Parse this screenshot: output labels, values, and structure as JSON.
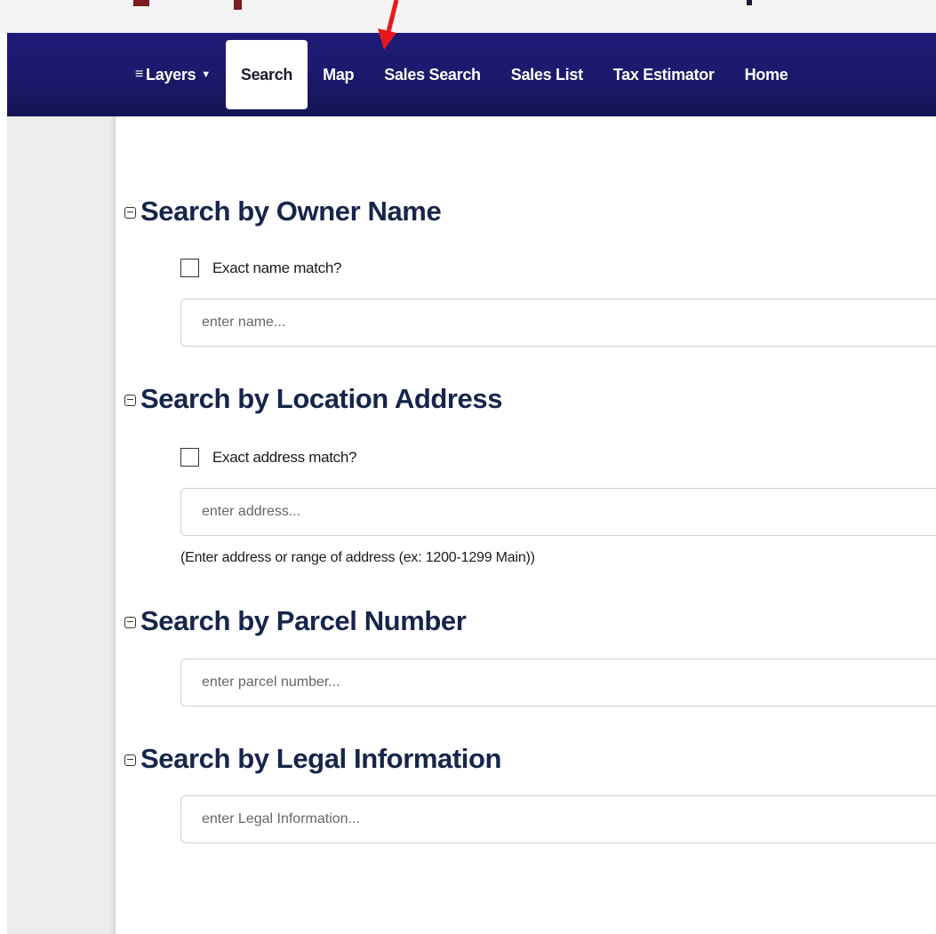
{
  "navbar": {
    "items": [
      {
        "label": "Layers",
        "icon": "layers-icon",
        "has_dropdown": true
      },
      {
        "label": "Search",
        "active": true
      },
      {
        "label": "Map"
      },
      {
        "label": "Sales Search"
      },
      {
        "label": "Sales List"
      },
      {
        "label": "Tax Estimator"
      },
      {
        "label": "Home"
      }
    ],
    "colors": {
      "background": "#1c1a6e",
      "text": "#ffffff",
      "active_background": "#ffffff",
      "active_text": "#1b1b2e"
    }
  },
  "annotation": {
    "type": "red-arrow",
    "points_to": "Map",
    "color": "#e8161b"
  },
  "sections": {
    "owner": {
      "title": "Search by Owner Name",
      "checkbox_label": "Exact name match?",
      "checkbox_checked": false,
      "input_placeholder": "enter name...",
      "input_value": ""
    },
    "address": {
      "title": "Search by Location Address",
      "checkbox_label": "Exact address match?",
      "checkbox_checked": false,
      "input_placeholder": "enter address...",
      "input_value": "",
      "helper": "(Enter address or range of address (ex: 1200-1299 Main))"
    },
    "parcel": {
      "title": "Search by Parcel Number",
      "input_placeholder": "enter parcel number...",
      "input_value": ""
    },
    "legal": {
      "title": "Search by Legal Information",
      "input_placeholder": "enter Legal Information...",
      "input_value": ""
    }
  },
  "colors": {
    "heading": "#17254a",
    "sidebar": "#ececec",
    "accent_arrow": "#e8161b"
  }
}
